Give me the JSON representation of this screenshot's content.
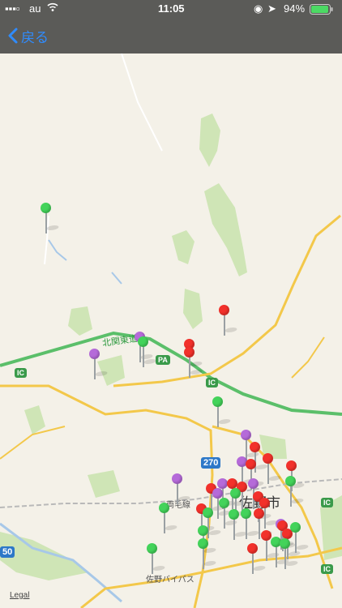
{
  "status": {
    "carrier": "au",
    "time": "11:05",
    "battery_percent": "94%"
  },
  "nav": {
    "back_label": "戻る"
  },
  "map": {
    "labels": {
      "expressway": "北関東道",
      "city": "佐野市",
      "line": "両毛線",
      "bypass": "佐野バイパス",
      "route270": "270",
      "route50": "50",
      "ic1": "IC",
      "ic2": "IC",
      "ic3": "IC",
      "ic4": "IC",
      "pa": "PA"
    },
    "legal": "Legal"
  },
  "colors": {
    "red": "#f2312b",
    "green": "#43d35a",
    "purple": "#b56ad9",
    "accent": "#2f8cff"
  }
}
